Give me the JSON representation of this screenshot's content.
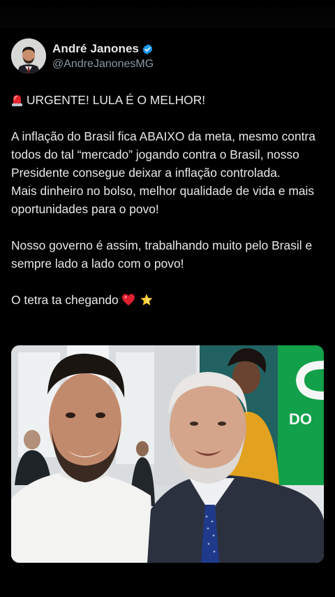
{
  "author": {
    "display_name": "André Janones",
    "handle": "@AndreJanonesMG",
    "verified_color": "#1d9bf0"
  },
  "tweet": {
    "lines": {
      "headline": "URGENTE! LULA É O MELHOR!",
      "para1": "A inflação do Brasil fica ABAIXO da meta, mesmo contra todos do tal “mercado” jogando contra o Brasil, nosso Presidente consegue deixar a inflação controlada.",
      "para2": "Mais dinheiro no bolso, melhor qualidade de vida e mais oportunidades para o povo!",
      "para3": "Nosso governo é assim, trabalhando muito  pelo Brasil e sempre lado a lado com o povo!",
      "para4": "O tetra ta chegando"
    },
    "emojis": [
      "rotating-light-icon",
      "red-heart-icon",
      "glowing-star-icon"
    ]
  },
  "media": {
    "sign_text": "DO",
    "sign_letter": "C",
    "colors": {
      "sign_green": "#12a04a",
      "background": "#0b0b0b"
    }
  }
}
